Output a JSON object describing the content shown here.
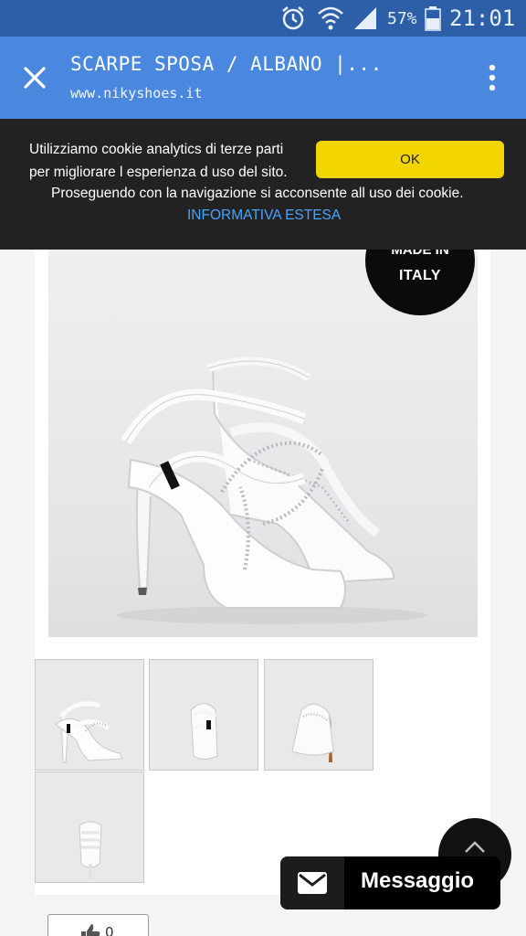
{
  "status_bar": {
    "battery_text": "57%",
    "time": "21:01",
    "icons": [
      "alarm-icon",
      "wifi-icon",
      "signal-icon",
      "battery-icon"
    ]
  },
  "app_bar": {
    "title": "SCARPE SPOSA / ALBANO |...",
    "url": "www.nikyshoes.it",
    "background": "#4a88e0"
  },
  "cookie_banner": {
    "line1": "Utilizziamo cookie analytics di terze parti",
    "line2": "per migliorare l esperienza d uso del sito.",
    "line3": "Proseguendo con la navigazione si acconsente all uso dei cookie.",
    "link": "INFORMATIVA ESTESA",
    "ok_label": "OK",
    "ok_color": "#f1d400"
  },
  "product": {
    "badge_top": "MADE IN",
    "badge_main": "ITALY",
    "thumbnail_count": 4
  },
  "like": {
    "count": "0"
  },
  "chat": {
    "label": "Messaggio"
  }
}
